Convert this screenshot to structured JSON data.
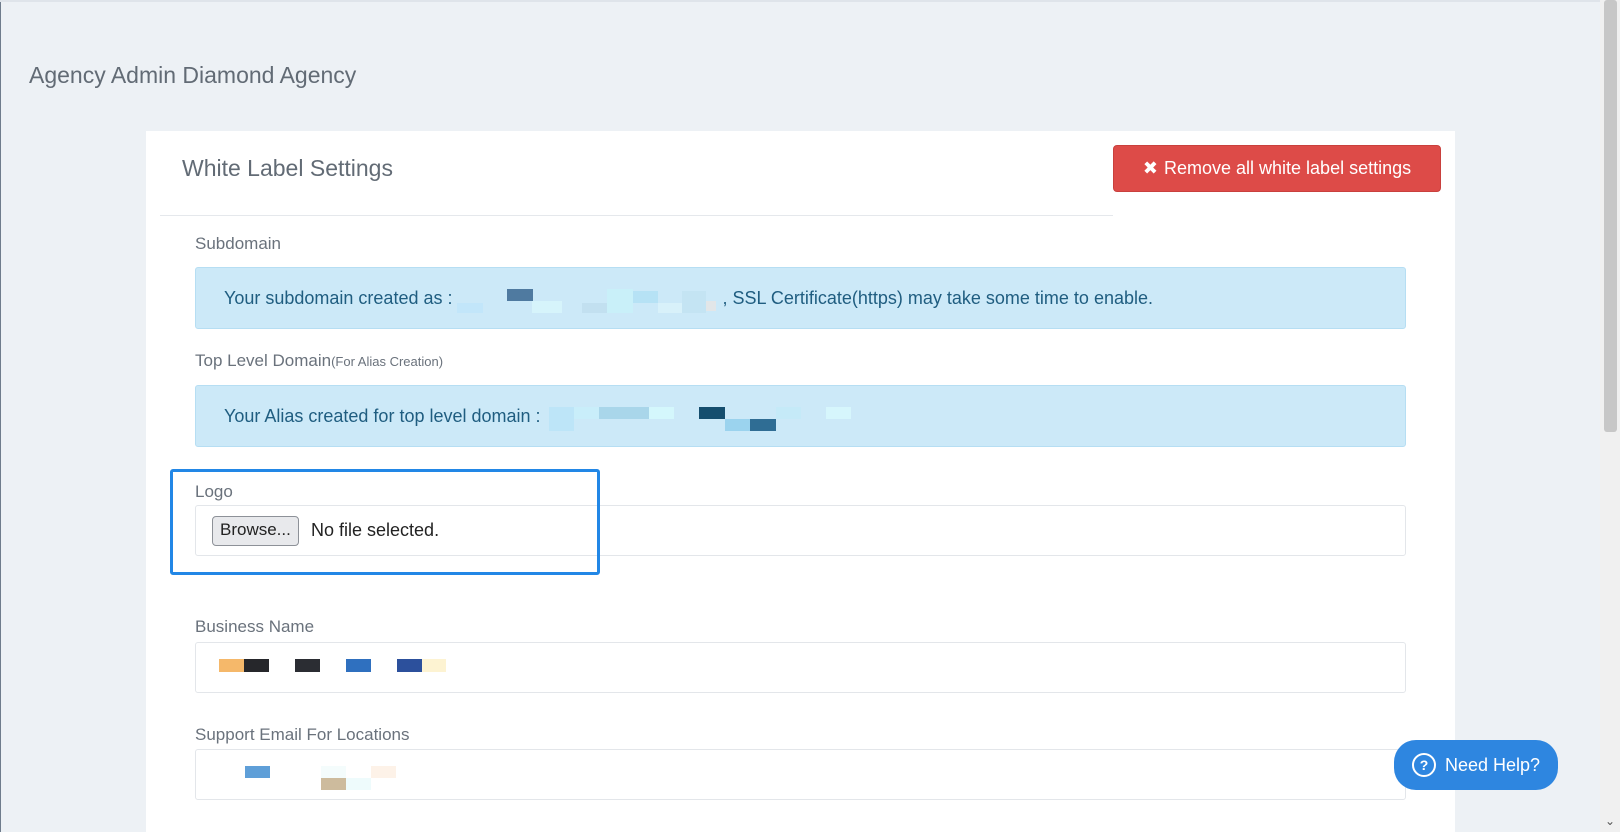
{
  "page": {
    "title": "Agency Admin Diamond Agency"
  },
  "card": {
    "title": "White Label Settings",
    "remove_button": {
      "icon": "close-icon",
      "x_glyph": "✖",
      "label": "Remove all white label settings"
    }
  },
  "subdomain": {
    "label": "Subdomain",
    "prefix": "Your subdomain created as :",
    "suffix": ", SSL Certificate(https) may take some time to enable."
  },
  "top_level_domain": {
    "label": "Top Level Domain",
    "label_note": "(For Alias Creation)",
    "prefix": "Your Alias created for top level domain :"
  },
  "logo": {
    "label": "Logo",
    "browse_label": "Browse...",
    "file_status": "No file selected."
  },
  "business_name": {
    "label": "Business Name"
  },
  "support_email": {
    "label": "Support Email For Locations"
  },
  "help_button": {
    "icon": "question-circle-icon",
    "icon_glyph": "?",
    "label": "Need Help?"
  },
  "colors": {
    "danger": "#dd4b48",
    "info_bg": "#cce9f8",
    "info_text": "#1f5d80",
    "accent": "#2287e6",
    "help": "#2e86e0"
  }
}
